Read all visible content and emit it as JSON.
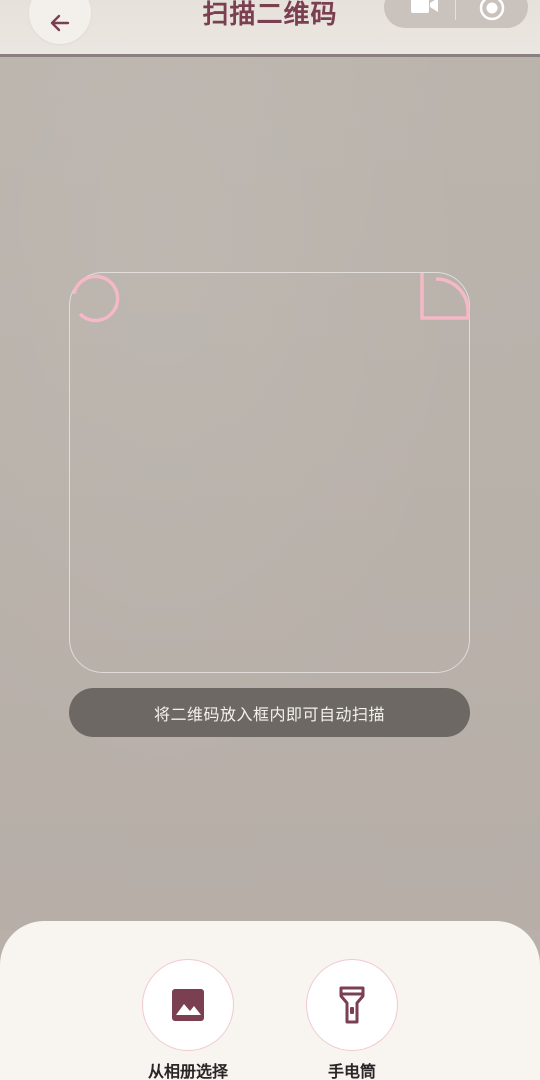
{
  "header": {
    "title": "扫描二维码",
    "back_icon": "arrow-left-icon",
    "right_icons": [
      "video-camera-icon",
      "record-icon"
    ]
  },
  "scanner": {
    "hint": "将二维码放入框内即可自动扫描",
    "accent_color": "#f5b8c6"
  },
  "actions": {
    "album": {
      "label": "从相册选择",
      "icon": "image-icon"
    },
    "flashlight": {
      "label": "手电筒",
      "icon": "flashlight-icon"
    }
  },
  "colors": {
    "title": "#7a3f51",
    "icon": "#7a3f51",
    "panel_bg": "#f8f5f1"
  }
}
